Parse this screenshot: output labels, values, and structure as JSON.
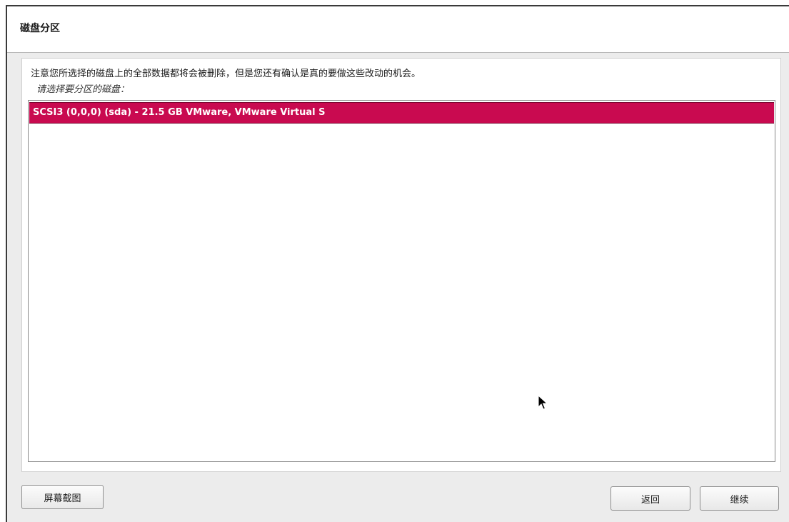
{
  "header": {
    "title": "磁盘分区"
  },
  "content": {
    "notice": "注意您所选择的磁盘上的全部数据都将会被删除，但是您还有确认是真的要做这些改动的机会。",
    "prompt": "请选择要分区的磁盘："
  },
  "disk_list": {
    "items": [
      {
        "label": "SCSI3 (0,0,0) (sda) - 21.5 GB VMware, VMware Virtual S",
        "selected": true
      }
    ]
  },
  "footer": {
    "screenshot_label": "屏幕截图",
    "back_label": "返回",
    "continue_label": "继续"
  },
  "colors": {
    "selection": "#c90a50",
    "background": "#ececec"
  },
  "icons": {
    "cursor": "mouse-pointer-icon"
  }
}
